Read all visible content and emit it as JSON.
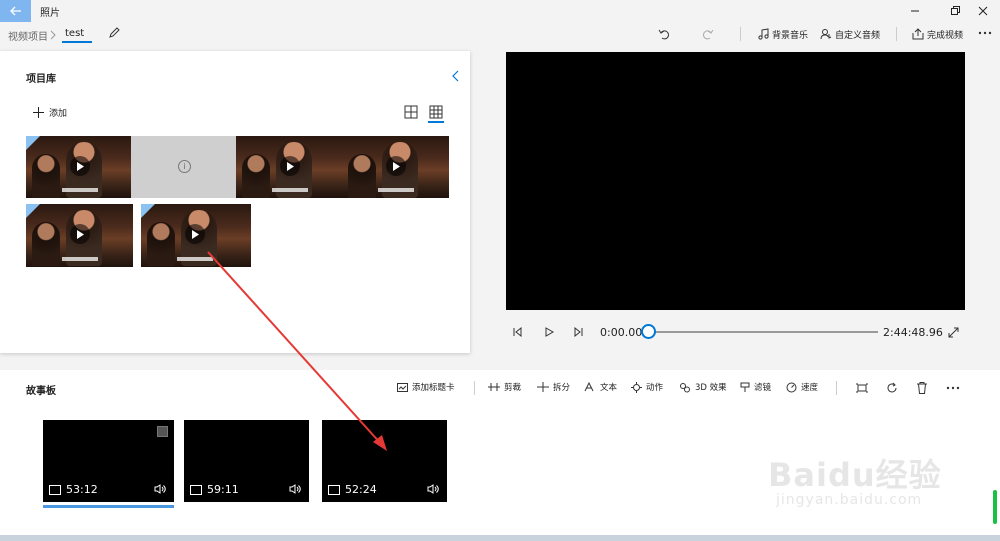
{
  "app": {
    "title": "照片",
    "accent": "#0078d7"
  },
  "breadcrumb": {
    "parent": "视频项目",
    "current": "test"
  },
  "toolbar": {
    "background_music": "背景音乐",
    "custom_audio": "自定义音频",
    "finish_video": "完成视频"
  },
  "library": {
    "title": "项目库",
    "add_label": "添加"
  },
  "player": {
    "current_time": "0:00.00",
    "total_time": "2:44:48.96"
  },
  "storyboard": {
    "title": "故事板",
    "add_title_card": "添加标题卡",
    "trim": "剪裁",
    "split": "拆分",
    "text": "文本",
    "motion": "动作",
    "effects_3d": "3D 效果",
    "filters": "滤镜",
    "speed": "速度",
    "clips": [
      {
        "duration": "53:12"
      },
      {
        "duration": "59:11"
      },
      {
        "duration": "52:24"
      }
    ]
  },
  "watermark": {
    "brand": "Baidu经验",
    "url": "jingyan.baidu.com"
  }
}
